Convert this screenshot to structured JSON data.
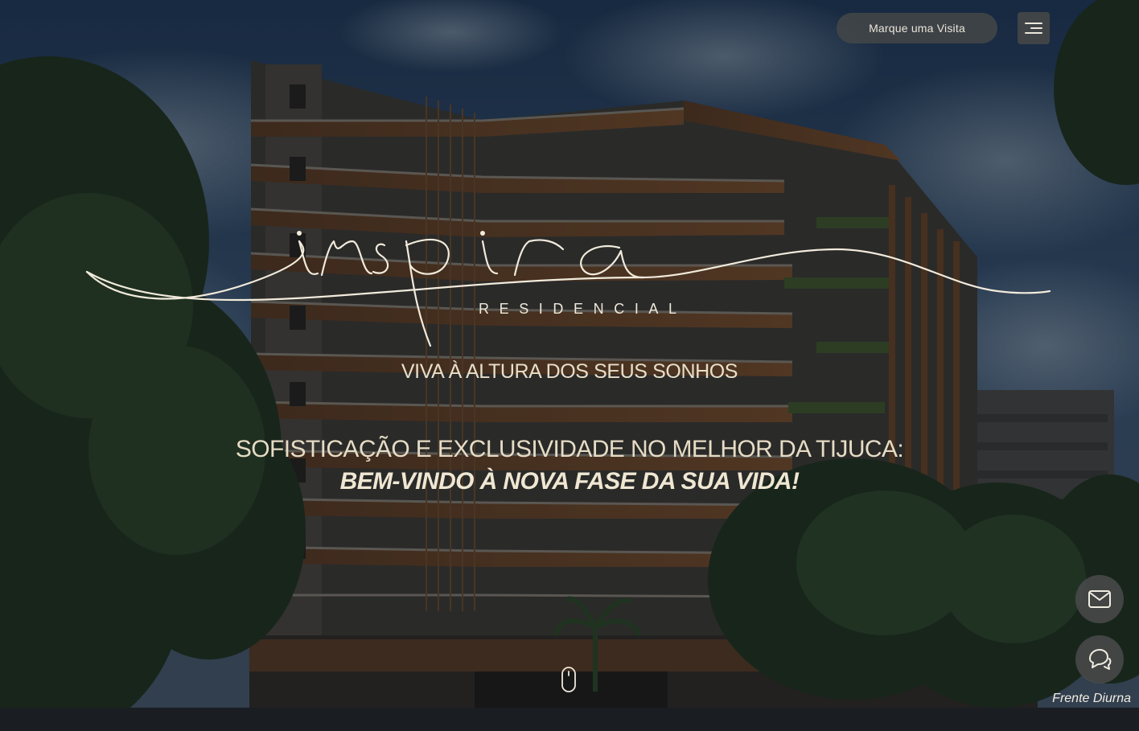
{
  "header": {
    "visit_button_label": "Marque uma Visita",
    "menu_icon": "hamburger-menu-icon"
  },
  "brand": {
    "logo_script": "inspira",
    "logo_sub": "RESIDENCIAL"
  },
  "hero": {
    "tagline": "VIVA À ALTURA DOS SEUS SONHOS",
    "headline_line1": "SOFISTICAÇÃO E EXCLUSIVIDADE NO MELHOR DA TIJUCA:",
    "headline_line2": "BEM-VINDO À NOVA FASE DA SUA VIDA!",
    "image_caption": "Frente Diurna",
    "scroll_icon": "mouse-scroll-icon"
  },
  "floating_actions": [
    {
      "icon": "mail-icon"
    },
    {
      "icon": "chat-bubbles-icon"
    }
  ],
  "colors": {
    "text_cream": "#e8dfc9",
    "button_bg": "#464848",
    "sky": "#2b4a6b"
  }
}
